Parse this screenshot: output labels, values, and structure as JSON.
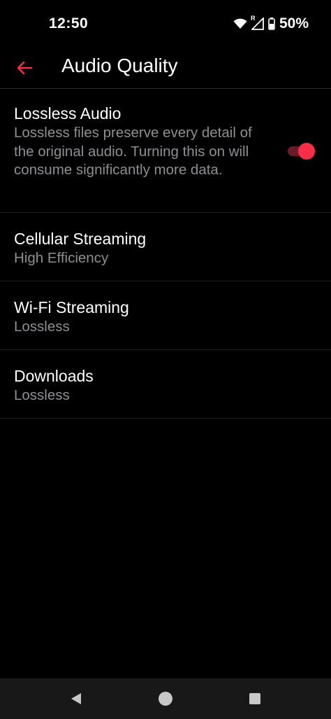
{
  "status_bar": {
    "time": "12:50",
    "icons": [
      "wifi-icon",
      "signal-roaming-icon",
      "battery-icon"
    ],
    "roaming_marker": "R",
    "battery_percent": "50%"
  },
  "app_bar": {
    "back_icon": "arrow-left-icon",
    "title": "Audio Quality"
  },
  "settings": {
    "lossless_audio": {
      "title": "Lossless Audio",
      "description": "Lossless files preserve every detail of the original audio. Turning this on will consume significantly more data.",
      "enabled": true
    },
    "cellular_streaming": {
      "title": "Cellular Streaming",
      "value": "High Efficiency"
    },
    "wifi_streaming": {
      "title": "Wi-Fi Streaming",
      "value": "Lossless"
    },
    "downloads": {
      "title": "Downloads",
      "value": "Lossless"
    }
  },
  "nav_bar": {
    "icons": [
      "nav-back-icon",
      "nav-home-icon",
      "nav-recents-icon"
    ]
  },
  "colors": {
    "accent": "#fa2d48",
    "accent_track": "#6b1a26",
    "background": "#000000",
    "secondary_text": "#8e8e93",
    "nav_background": "#181818"
  }
}
